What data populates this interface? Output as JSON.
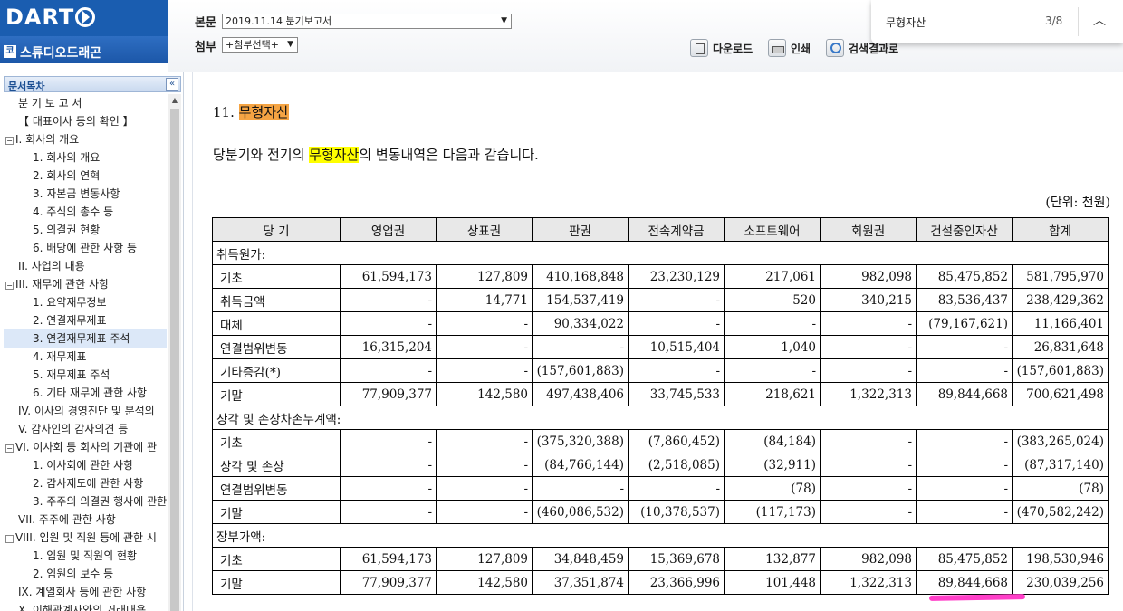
{
  "header": {
    "logo": "DART",
    "company": "스튜디오드래곤",
    "company_icon": "코",
    "doc_label": "본문",
    "doc_value": "2019.11.14   분기보고서",
    "attach_label": "첨부",
    "attach_value": "+첨부선택+",
    "download": "다운로드",
    "print": "인쇄",
    "search_result": "검색결과로"
  },
  "findbar": {
    "query": "무형자산",
    "count": "3/8"
  },
  "sidebar": {
    "title": "문서목차",
    "items": [
      {
        "label": "분 기 보 고 서",
        "indent": 1
      },
      {
        "label": "【 대표이사 등의 확인 】",
        "indent": 1
      },
      {
        "label": "I. 회사의 개요",
        "indent": 0,
        "toggle": true
      },
      {
        "label": "1. 회사의 개요",
        "indent": 2
      },
      {
        "label": "2. 회사의 연혁",
        "indent": 2
      },
      {
        "label": "3. 자본금 변동사항",
        "indent": 2
      },
      {
        "label": "4. 주식의 총수 등",
        "indent": 2
      },
      {
        "label": "5. 의결권 현황",
        "indent": 2
      },
      {
        "label": "6. 배당에 관한 사항 등",
        "indent": 2
      },
      {
        "label": "II. 사업의 내용",
        "indent": 1
      },
      {
        "label": "III. 재무에 관한 사항",
        "indent": 0,
        "toggle": true
      },
      {
        "label": "1. 요약재무정보",
        "indent": 2
      },
      {
        "label": "2. 연결재무제표",
        "indent": 2
      },
      {
        "label": "3. 연결재무제표 주석",
        "indent": 2,
        "selected": true
      },
      {
        "label": "4. 재무제표",
        "indent": 2
      },
      {
        "label": "5. 재무제표 주석",
        "indent": 2
      },
      {
        "label": "6. 기타 재무에 관한 사항",
        "indent": 2
      },
      {
        "label": "IV. 이사의 경영진단 및 분석의",
        "indent": 1
      },
      {
        "label": "V. 감사인의 감사의견 등",
        "indent": 1
      },
      {
        "label": "VI. 이사회 등 회사의 기관에 관",
        "indent": 0,
        "toggle": true
      },
      {
        "label": "1. 이사회에 관한 사항",
        "indent": 2
      },
      {
        "label": "2. 감사제도에 관한 사항",
        "indent": 2
      },
      {
        "label": "3. 주주의 의결권 행사에 관한",
        "indent": 2
      },
      {
        "label": "VII. 주주에 관한 사항",
        "indent": 1
      },
      {
        "label": "VIII. 임원 및 직원 등에 관한 시",
        "indent": 0,
        "toggle": true
      },
      {
        "label": "1. 임원 및 직원의 현황",
        "indent": 2
      },
      {
        "label": "2. 임원의 보수 등",
        "indent": 2
      },
      {
        "label": "IX. 계열회사 등에 관한 사항",
        "indent": 1
      },
      {
        "label": "X. 이해관계자와의 거래내용",
        "indent": 1
      }
    ]
  },
  "main": {
    "section_num": "11.",
    "section_title": "무형자산",
    "intro_pre": "당분기와 전기의 ",
    "intro_hl": "무형자산",
    "intro_post": "의 변동내역은 다음과 같습니다.",
    "unit": "(단위: 천원)",
    "table": {
      "headers": [
        "당  기",
        "영업권",
        "상표권",
        "판권",
        "전속계약금",
        "소프트웨어",
        "회원권",
        "건설중인자산",
        "합계"
      ],
      "rows": [
        {
          "type": "group",
          "label": "취득원가:"
        },
        {
          "type": "data",
          "label": "기초",
          "values": [
            "61,594,173",
            "127,809",
            "410,168,848",
            "23,230,129",
            "217,061",
            "982,098",
            "85,475,852",
            "581,795,970"
          ]
        },
        {
          "type": "data",
          "label": "취득금액",
          "values": [
            "-",
            "14,771",
            "154,537,419",
            "-",
            "520",
            "340,215",
            "83,536,437",
            "238,429,362"
          ]
        },
        {
          "type": "data",
          "label": "대체",
          "values": [
            "-",
            "-",
            "90,334,022",
            "-",
            "-",
            "-",
            "(79,167,621)",
            "11,166,401"
          ]
        },
        {
          "type": "data",
          "label": "연결범위변동",
          "values": [
            "16,315,204",
            "-",
            "-",
            "10,515,404",
            "1,040",
            "-",
            "-",
            "26,831,648"
          ]
        },
        {
          "type": "data",
          "label": "기타증감(*)",
          "values": [
            "-",
            "-",
            "(157,601,883)",
            "-",
            "-",
            "-",
            "-",
            "(157,601,883)"
          ]
        },
        {
          "type": "data",
          "label": "기말",
          "values": [
            "77,909,377",
            "142,580",
            "497,438,406",
            "33,745,533",
            "218,621",
            "1,322,313",
            "89,844,668",
            "700,621,498"
          ]
        },
        {
          "type": "group",
          "label": "상각 및 손상차손누계액:"
        },
        {
          "type": "data",
          "label": "기초",
          "values": [
            "-",
            "-",
            "(375,320,388)",
            "(7,860,452)",
            "(84,184)",
            "-",
            "-",
            "(383,265,024)"
          ]
        },
        {
          "type": "data",
          "label": "상각 및 손상",
          "values": [
            "-",
            "-",
            "(84,766,144)",
            "(2,518,085)",
            "(32,911)",
            "-",
            "-",
            "(87,317,140)"
          ]
        },
        {
          "type": "data",
          "label": "연결범위변동",
          "values": [
            "-",
            "-",
            "-",
            "-",
            "(78)",
            "-",
            "-",
            "(78)"
          ]
        },
        {
          "type": "data",
          "label": "기말",
          "values": [
            "-",
            "-",
            "(460,086,532)",
            "(10,378,537)",
            "(117,173)",
            "-",
            "-",
            "(470,582,242)"
          ]
        },
        {
          "type": "group",
          "label": "장부가액:"
        },
        {
          "type": "data",
          "label": "기초",
          "values": [
            "61,594,173",
            "127,809",
            "34,848,459",
            "15,369,678",
            "132,877",
            "982,098",
            "85,475,852",
            "198,530,946"
          ]
        },
        {
          "type": "data",
          "label": "기말",
          "values": [
            "77,909,377",
            "142,580",
            "37,351,874",
            "23,366,996",
            "101,448",
            "1,322,313",
            "89,844,668",
            "230,039,256"
          ]
        }
      ]
    }
  },
  "colors": {
    "brand": "#1a5db0",
    "highlight_current": "#f5a443",
    "highlight_match": "#ffff00",
    "annotation": "#ff3fc8"
  }
}
